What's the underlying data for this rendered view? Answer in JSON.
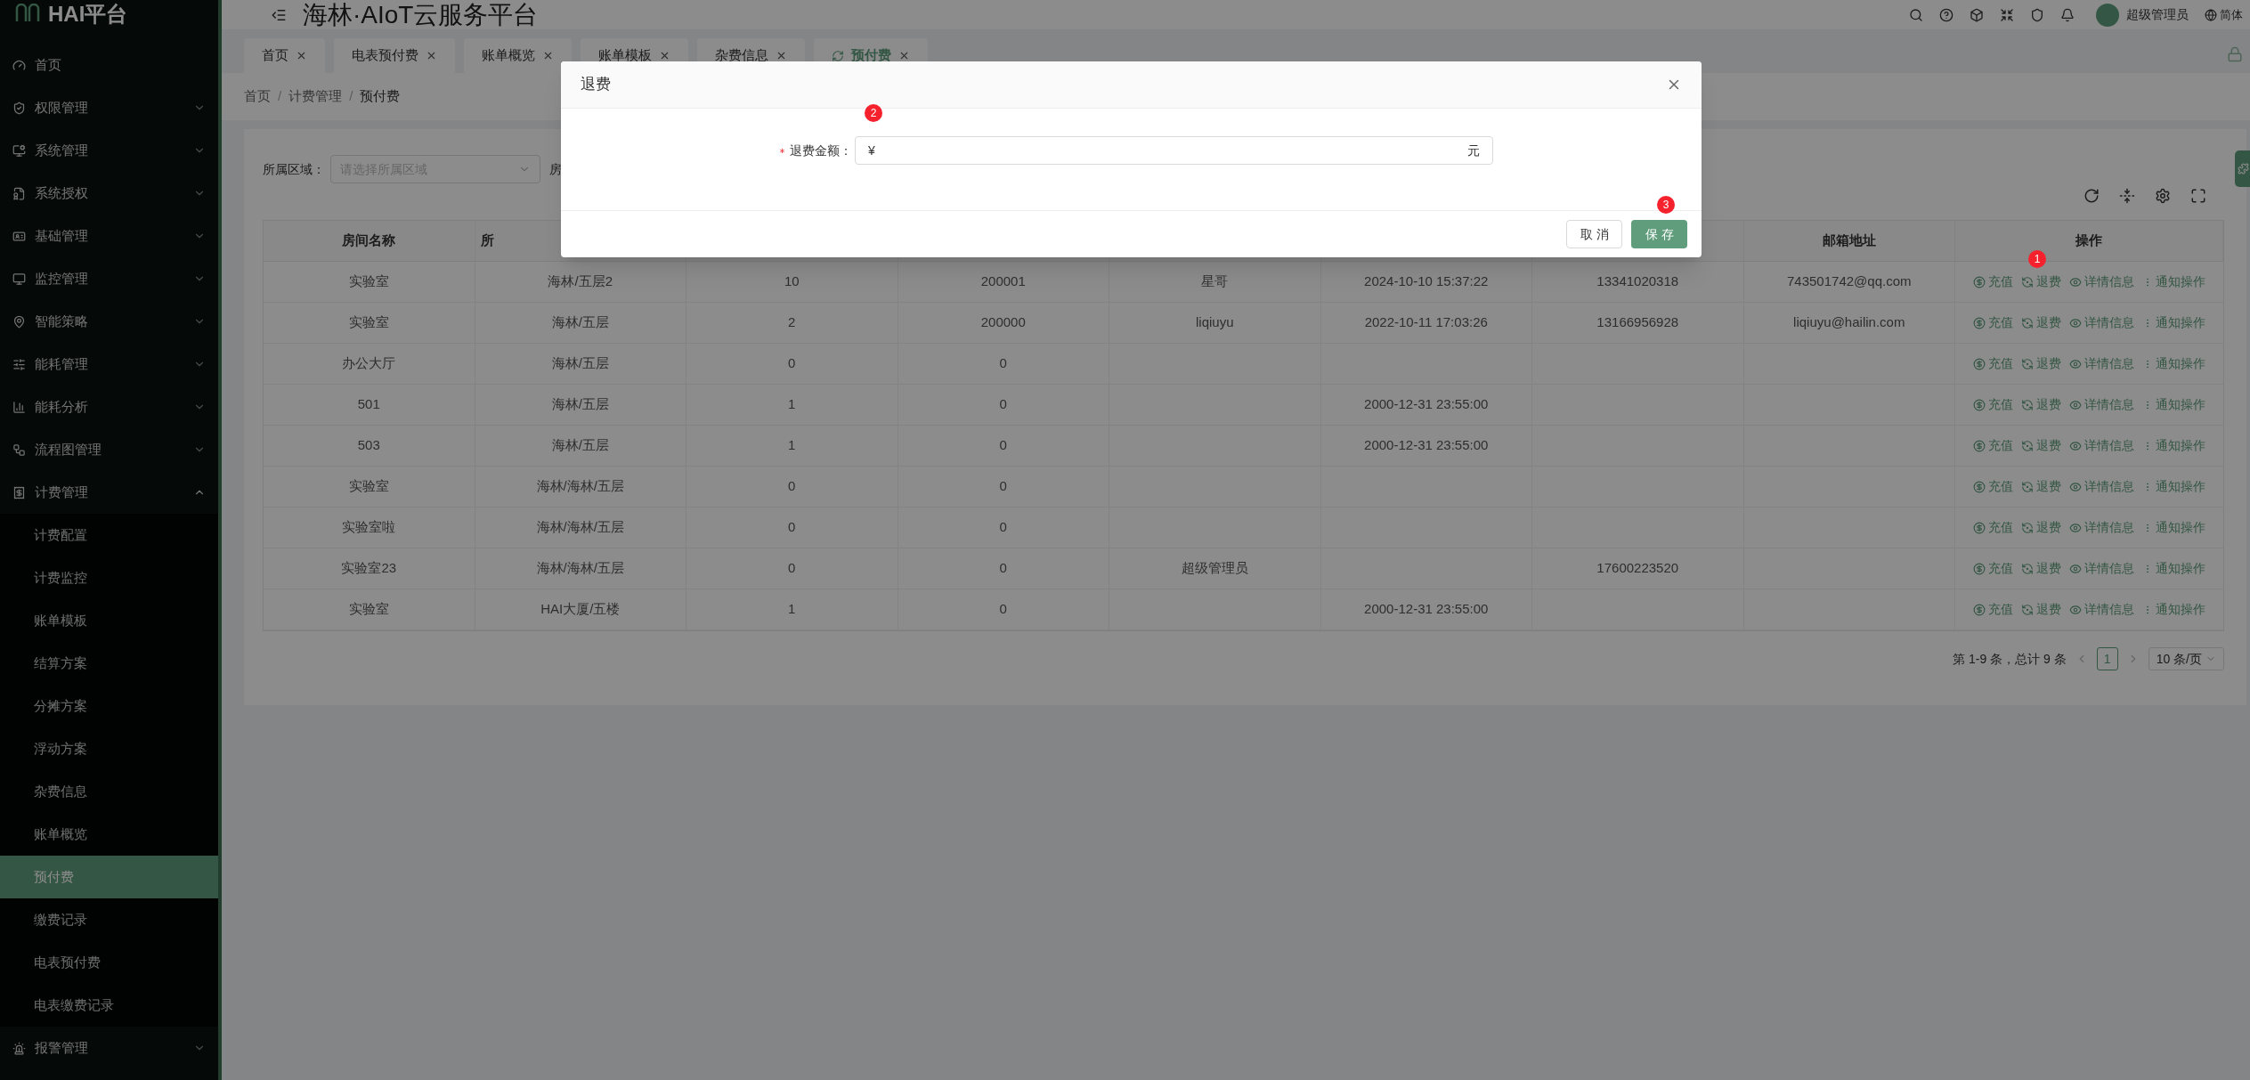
{
  "sidebar": {
    "logo": "HAI平台",
    "items": [
      {
        "label": "首页",
        "kind": "link"
      },
      {
        "label": "权限管理",
        "kind": "group",
        "expanded": false
      },
      {
        "label": "系统管理",
        "kind": "group",
        "expanded": false
      },
      {
        "label": "系统授权",
        "kind": "group",
        "expanded": false
      },
      {
        "label": "基础管理",
        "kind": "group",
        "expanded": false
      },
      {
        "label": "监控管理",
        "kind": "group",
        "expanded": false
      },
      {
        "label": "智能策略",
        "kind": "group",
        "expanded": false
      },
      {
        "label": "能耗管理",
        "kind": "group",
        "expanded": false
      },
      {
        "label": "能耗分析",
        "kind": "group",
        "expanded": false
      },
      {
        "label": "流程图管理",
        "kind": "group",
        "expanded": false
      },
      {
        "label": "计费管理",
        "kind": "group",
        "expanded": true,
        "children": [
          {
            "label": "计费配置",
            "selected": false
          },
          {
            "label": "计费监控",
            "selected": false
          },
          {
            "label": "账单模板",
            "selected": false
          },
          {
            "label": "结算方案",
            "selected": false
          },
          {
            "label": "分摊方案",
            "selected": false
          },
          {
            "label": "浮动方案",
            "selected": false
          },
          {
            "label": "杂费信息",
            "selected": false
          },
          {
            "label": "账单概览",
            "selected": false
          },
          {
            "label": "预付费",
            "selected": true
          },
          {
            "label": "缴费记录",
            "selected": false
          },
          {
            "label": "电表预付费",
            "selected": false
          },
          {
            "label": "电表缴费记录",
            "selected": false
          }
        ]
      },
      {
        "label": "报警管理",
        "kind": "group",
        "expanded": false
      }
    ]
  },
  "header": {
    "title": "海林·AIoT云服务平台",
    "user": "超级管理员",
    "language": "简体"
  },
  "tabs": [
    {
      "label": "首页",
      "selected": false
    },
    {
      "label": "电表预付费",
      "selected": false
    },
    {
      "label": "账单概览",
      "selected": false
    },
    {
      "label": "账单模板",
      "selected": false
    },
    {
      "label": "杂费信息",
      "selected": false
    },
    {
      "label": "预付费",
      "selected": true
    }
  ],
  "breadcrumb": [
    "首页",
    "计费管理",
    "预付费"
  ],
  "breadcrumb_separator": "/",
  "filters": [
    {
      "label": "所属区域：",
      "placeholder": "请选择所属区域"
    },
    {
      "label": "房"
    }
  ],
  "table": {
    "columns": [
      "房间名称",
      "所",
      null,
      null,
      null,
      null,
      null,
      "邮箱地址",
      "操作"
    ],
    "rows": [
      {
        "cells": [
          "实验室",
          "海林/五层2",
          "10",
          "200001",
          "星哥",
          "2024-10-10 15:37:22",
          "13341020318",
          "743501742@qq.com"
        ],
        "actions": [
          {
            "kind": "recharge",
            "label": "充值"
          },
          {
            "kind": "refund",
            "label": "退费",
            "marker": "1"
          },
          {
            "kind": "detail",
            "label": "详情信息"
          },
          {
            "kind": "notify",
            "label": "通知操作"
          }
        ]
      },
      {
        "cells": [
          "实验室",
          "海林/五层",
          "2",
          "200000",
          "liqiuyu",
          "2022-10-11 17:03:26",
          "13166956928",
          "liqiuyu@hailin.com"
        ],
        "actions": [
          {
            "kind": "recharge",
            "label": "充值"
          },
          {
            "kind": "refund",
            "label": "退费"
          },
          {
            "kind": "detail",
            "label": "详情信息"
          },
          {
            "kind": "notify",
            "label": "通知操作"
          }
        ]
      },
      {
        "cells": [
          "办公大厅",
          "海林/五层",
          "0",
          "0",
          null,
          null,
          null,
          null
        ],
        "actions": [
          {
            "kind": "recharge",
            "label": "充值"
          },
          {
            "kind": "refund",
            "label": "退费"
          },
          {
            "kind": "detail",
            "label": "详情信息"
          },
          {
            "kind": "notify",
            "label": "通知操作"
          }
        ]
      },
      {
        "cells": [
          "501",
          "海林/五层",
          "1",
          "0",
          null,
          "2000-12-31 23:55:00",
          null,
          null
        ],
        "actions": [
          {
            "kind": "recharge",
            "label": "充值"
          },
          {
            "kind": "refund",
            "label": "退费"
          },
          {
            "kind": "detail",
            "label": "详情信息"
          },
          {
            "kind": "notify",
            "label": "通知操作"
          }
        ]
      },
      {
        "cells": [
          "503",
          "海林/五层",
          "1",
          "0",
          null,
          "2000-12-31 23:55:00",
          null,
          null
        ],
        "actions": [
          {
            "kind": "recharge",
            "label": "充值"
          },
          {
            "kind": "refund",
            "label": "退费"
          },
          {
            "kind": "detail",
            "label": "详情信息"
          },
          {
            "kind": "notify",
            "label": "通知操作"
          }
        ]
      },
      {
        "cells": [
          "实验室",
          "海林/海林/五层",
          "0",
          "0",
          null,
          null,
          null,
          null
        ],
        "actions": [
          {
            "kind": "recharge",
            "label": "充值"
          },
          {
            "kind": "refund",
            "label": "退费"
          },
          {
            "kind": "detail",
            "label": "详情信息"
          },
          {
            "kind": "notify",
            "label": "通知操作"
          }
        ]
      },
      {
        "cells": [
          "实验室啦",
          "海林/海林/五层",
          "0",
          "0",
          null,
          null,
          null,
          null
        ],
        "actions": [
          {
            "kind": "recharge",
            "label": "充值"
          },
          {
            "kind": "refund",
            "label": "退费"
          },
          {
            "kind": "detail",
            "label": "详情信息"
          },
          {
            "kind": "notify",
            "label": "通知操作"
          }
        ]
      },
      {
        "cells": [
          "实验室23",
          "海林/海林/五层",
          "0",
          "0",
          "超级管理员",
          null,
          "17600223520",
          null
        ],
        "actions": [
          {
            "kind": "recharge",
            "label": "充值"
          },
          {
            "kind": "refund",
            "label": "退费"
          },
          {
            "kind": "detail",
            "label": "详情信息"
          },
          {
            "kind": "notify",
            "label": "通知操作"
          }
        ]
      },
      {
        "cells": [
          "实验室",
          "HAI大厦/五楼",
          "1",
          "0",
          null,
          "2000-12-31 23:55:00",
          null,
          null
        ],
        "actions": [
          {
            "kind": "recharge",
            "label": "充值"
          },
          {
            "kind": "refund",
            "label": "退费"
          },
          {
            "kind": "detail",
            "label": "详情信息"
          },
          {
            "kind": "notify",
            "label": "通知操作"
          }
        ]
      }
    ]
  },
  "pagination": {
    "summary": "第 1-9 条，总计 9 条",
    "pages": [
      {
        "label": "1",
        "selected": true
      }
    ],
    "page_size": "10 条/页"
  },
  "modal": {
    "title": "退费",
    "field": {
      "label": "退费金额：",
      "required": true,
      "prefix": "¥",
      "suffix": "元",
      "marker": "2"
    },
    "buttons": [
      {
        "kind": "default",
        "label": "取消"
      },
      {
        "kind": "primary",
        "label": "保存",
        "marker": "3"
      }
    ]
  }
}
